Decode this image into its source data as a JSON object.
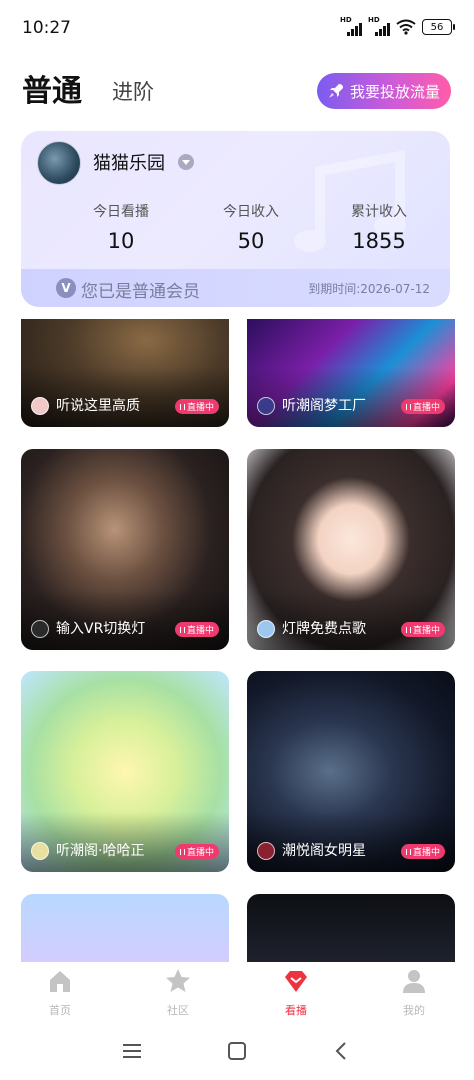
{
  "status_bar": {
    "time": "10:27",
    "signal_label_1": "HD",
    "signal_label_2": "HD",
    "battery": "56"
  },
  "header": {
    "tab_active": "普通",
    "tab_inactive": "进阶",
    "promo_button": "我要投放流量"
  },
  "member_card": {
    "name": "猫猫乐园",
    "stats": [
      {
        "label": "今日看播",
        "value": "10"
      },
      {
        "label": "今日收入",
        "value": "50"
      },
      {
        "label": "累计收入",
        "value": "1855"
      }
    ],
    "vip_badge": "V",
    "vip_status": "您已是普通会员",
    "expire": "到期时间:2026-07-12"
  },
  "live_badge_text": "直播中",
  "feed": [
    {
      "title": "听说这里高质",
      "live": true
    },
    {
      "title": "听潮阁梦工厂",
      "live": true
    },
    {
      "title": "输入VR切换灯",
      "live": true
    },
    {
      "title": "灯牌免费点歌",
      "live": true
    },
    {
      "title": "听潮阁·哈哈正",
      "live": true
    },
    {
      "title": "潮悦阁女明星",
      "live": true
    },
    {
      "title": "",
      "live": false
    },
    {
      "title": "",
      "live": false
    }
  ],
  "bottom_nav": [
    {
      "label": "首页",
      "icon": "home-icon",
      "active": false
    },
    {
      "label": "社区",
      "icon": "star-icon",
      "active": false
    },
    {
      "label": "看播",
      "icon": "diamond-icon",
      "active": true
    },
    {
      "label": "我的",
      "icon": "person-icon",
      "active": false
    }
  ],
  "colors": {
    "accent": "#ee3340",
    "live_badge": "#ee3a6e",
    "promo_gradient_start": "#7b5cf0",
    "promo_gradient_end": "#ff5ca8"
  }
}
